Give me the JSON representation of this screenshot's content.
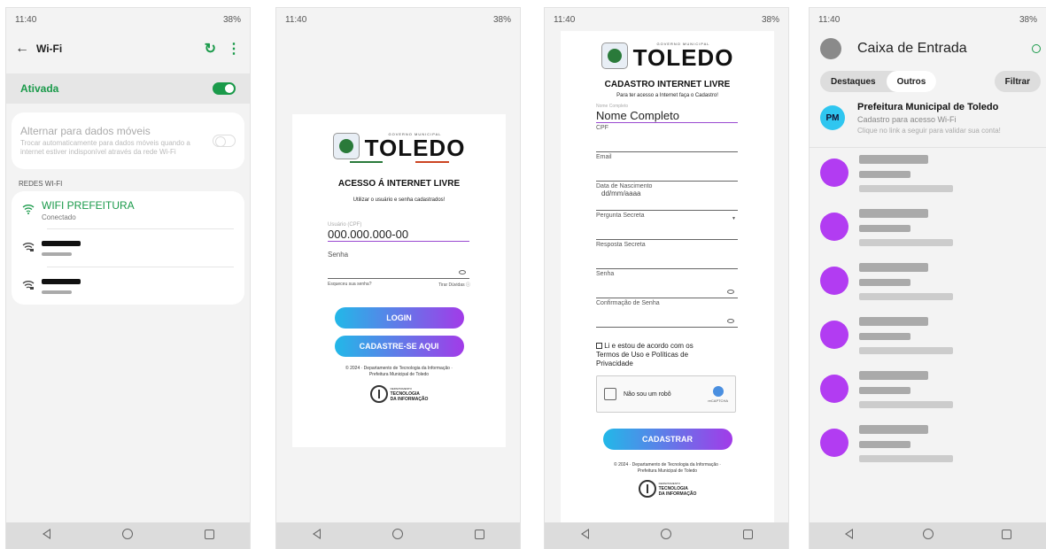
{
  "status": {
    "time": "11:40",
    "right": "38%"
  },
  "wifi": {
    "title": "Wi-Fi",
    "enabled_label": "Ativada",
    "alt_title": "Alternar para dados móveis",
    "alt_desc": "Trocar automaticamente para dados móveis quando a internet estiver indisponível através da rede Wi-Fi",
    "section": "REDES WI-FI",
    "connected_name": "WIFI PREFEITURA",
    "connected_status": "Conectado"
  },
  "login": {
    "gov": "GOVERNO MUNICIPAL",
    "brand": "TOLEDO",
    "title": "ACESSO Á INTERNET LIVRE",
    "subtitle": "Utilizar o usuário e senha cadastrados!",
    "user_label": "Usuário (CPF)",
    "user_value": "000.000.000-00",
    "password_label": "Senha",
    "forgot": "Esqueceu sua senha?",
    "help": "Tirar Dúvidas ⓘ",
    "login_btn": "LOGIN",
    "register_btn": "CADASTRE-SE AQUI",
    "footer": "© 2024 · Departamento de Tecnologia da Informação · Prefeitura Municipal de Toledo",
    "dept_small": "DEPARTAMENTO",
    "dept_l1": "TECNOLOGIA",
    "dept_l2": "DA INFORMAÇÃO"
  },
  "cadastro": {
    "title": "CADASTRO INTERNET LIVRE",
    "subtitle": "Para ter acesso a Internet faça o Cadastro!",
    "name_label": "Nome Completo",
    "name_value": "Nome Completo",
    "cpf": "CPF",
    "email": "Email",
    "birth": "Data de Nascimento",
    "birth_value": "dd/mm/aaaa",
    "question": "Pergunta Secreta",
    "answer": "Resposta Secreta",
    "password": "Senha",
    "confirm": "Confirmação de Senha",
    "terms": "Li e estou de acordo com os Termos de Uso e Políticas de Privacidade",
    "captcha": "Não sou um robô",
    "recaptcha": "reCAPTCHA",
    "submit": "CADASTRAR",
    "footer": "© 2024 · Departamento de Tecnologia da Informação · Prefeitura Municipal de Toledo"
  },
  "inbox": {
    "title": "Caixa de Entrada",
    "tab1": "Destaques",
    "tab2": "Outros",
    "filter": "Filtrar",
    "avatar": "PM",
    "sender": "Prefeitura Municipal de Toledo",
    "subject": "Cadastro para acesso Wi-Fi",
    "preview": "Clique no link a seguir para validar sua conta!"
  }
}
